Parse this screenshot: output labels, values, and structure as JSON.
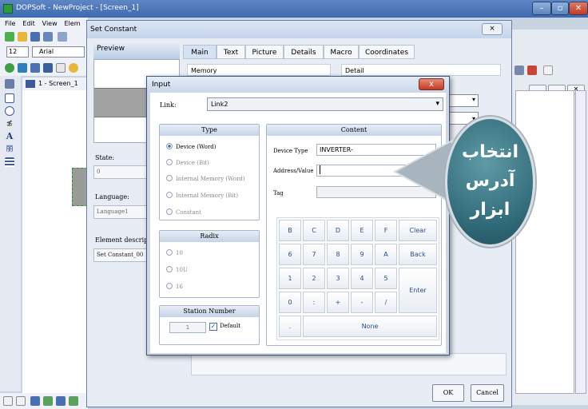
{
  "window": {
    "title": "DOPSoft - NewProject - [Screen_1]"
  },
  "menu": [
    "File",
    "Edit",
    "View",
    "Elem"
  ],
  "format_bar": {
    "font_size": "12",
    "font_name": "Arial"
  },
  "screen_tab": "1 - Screen_1",
  "set_constant": {
    "title": "Set Constant",
    "close_label": "⨯",
    "preview_label": "Preview",
    "tabs": [
      "Main",
      "Text",
      "Picture",
      "Details",
      "Macro",
      "Coordinates"
    ],
    "memory_label": "Memory",
    "detail_label": "Detail",
    "state_label": "State:",
    "state_value": "0",
    "language_label": "Language:",
    "language_value": "Language1",
    "element_desc_label": "Element descriptio",
    "element_desc_value": "Set Constant_00",
    "ok_label": "OK",
    "cancel_label": "Cancel",
    "dropdown2_fragment": "al"
  },
  "input": {
    "title": "Input",
    "close_label": "x",
    "link_label": "Link:",
    "link_value": "Link2",
    "type": {
      "header": "Type",
      "options": [
        {
          "label": "Device (Word)",
          "selected": true
        },
        {
          "label": "Device (Bit)",
          "selected": false
        },
        {
          "label": "Internal Memory (Word)",
          "selected": false
        },
        {
          "label": "Internal Memory (Bit)",
          "selected": false
        },
        {
          "label": "Constant",
          "selected": false
        }
      ]
    },
    "radix": {
      "header": "Radix",
      "options": [
        {
          "label": "10",
          "selected": false
        },
        {
          "label": "10U",
          "selected": false
        },
        {
          "label": "16",
          "selected": false
        }
      ]
    },
    "station": {
      "header": "Station Number",
      "value": "1",
      "default_label": "Default",
      "default_checked": true
    },
    "content": {
      "header": "Content",
      "device_type_label": "Device Type",
      "device_type_value": "INVERTER-",
      "address_label": "Address/Value",
      "address_value": "",
      "tag_label": "Tag",
      "tag_value": ""
    },
    "keypad": {
      "row1": [
        "B",
        "C",
        "D",
        "E",
        "F",
        "Clear"
      ],
      "row2": [
        "6",
        "7",
        "8",
        "9",
        "A",
        "Back"
      ],
      "row3": [
        "1",
        "2",
        "3",
        "4",
        "5"
      ],
      "row4": [
        "0",
        ":",
        "+",
        "-",
        "/"
      ],
      "enter": "Enter",
      "dot": ".",
      "none": "None"
    }
  },
  "callout": {
    "lines": [
      "انتخاب",
      "آدرس",
      "ابزار"
    ],
    "color": "#2e6775"
  }
}
